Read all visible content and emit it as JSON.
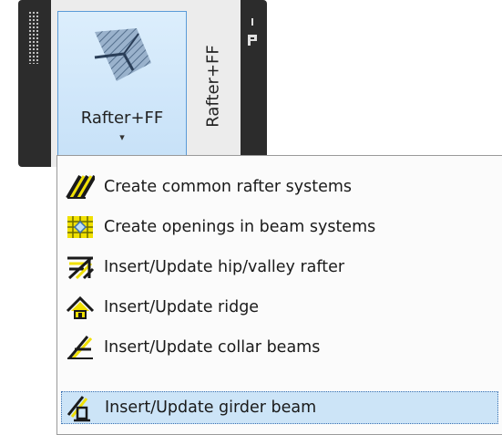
{
  "panel": {
    "button_label": "Rafter+FF",
    "dropdown_caret": "▾",
    "tab_label": "Rafter+FF"
  },
  "menu": {
    "items": [
      {
        "label": "Create common rafter systems",
        "icon": "common-rafter-icon"
      },
      {
        "label": "Create openings in beam systems",
        "icon": "beam-opening-icon"
      },
      {
        "label": "Insert/Update hip/valley rafter",
        "icon": "hip-valley-rafter-icon"
      },
      {
        "label": "Insert/Update ridge",
        "icon": "ridge-icon"
      },
      {
        "label": "Insert/Update collar beams",
        "icon": "collar-beam-icon"
      },
      {
        "label": "Insert/Update girder beam",
        "icon": "girder-beam-icon",
        "highlighted": true
      }
    ]
  },
  "colors": {
    "panel_dark": "#2c2c2c",
    "button_highlight": "#cce4f7",
    "icon_yellow": "#f0e000",
    "icon_black": "#1a1a1a"
  }
}
